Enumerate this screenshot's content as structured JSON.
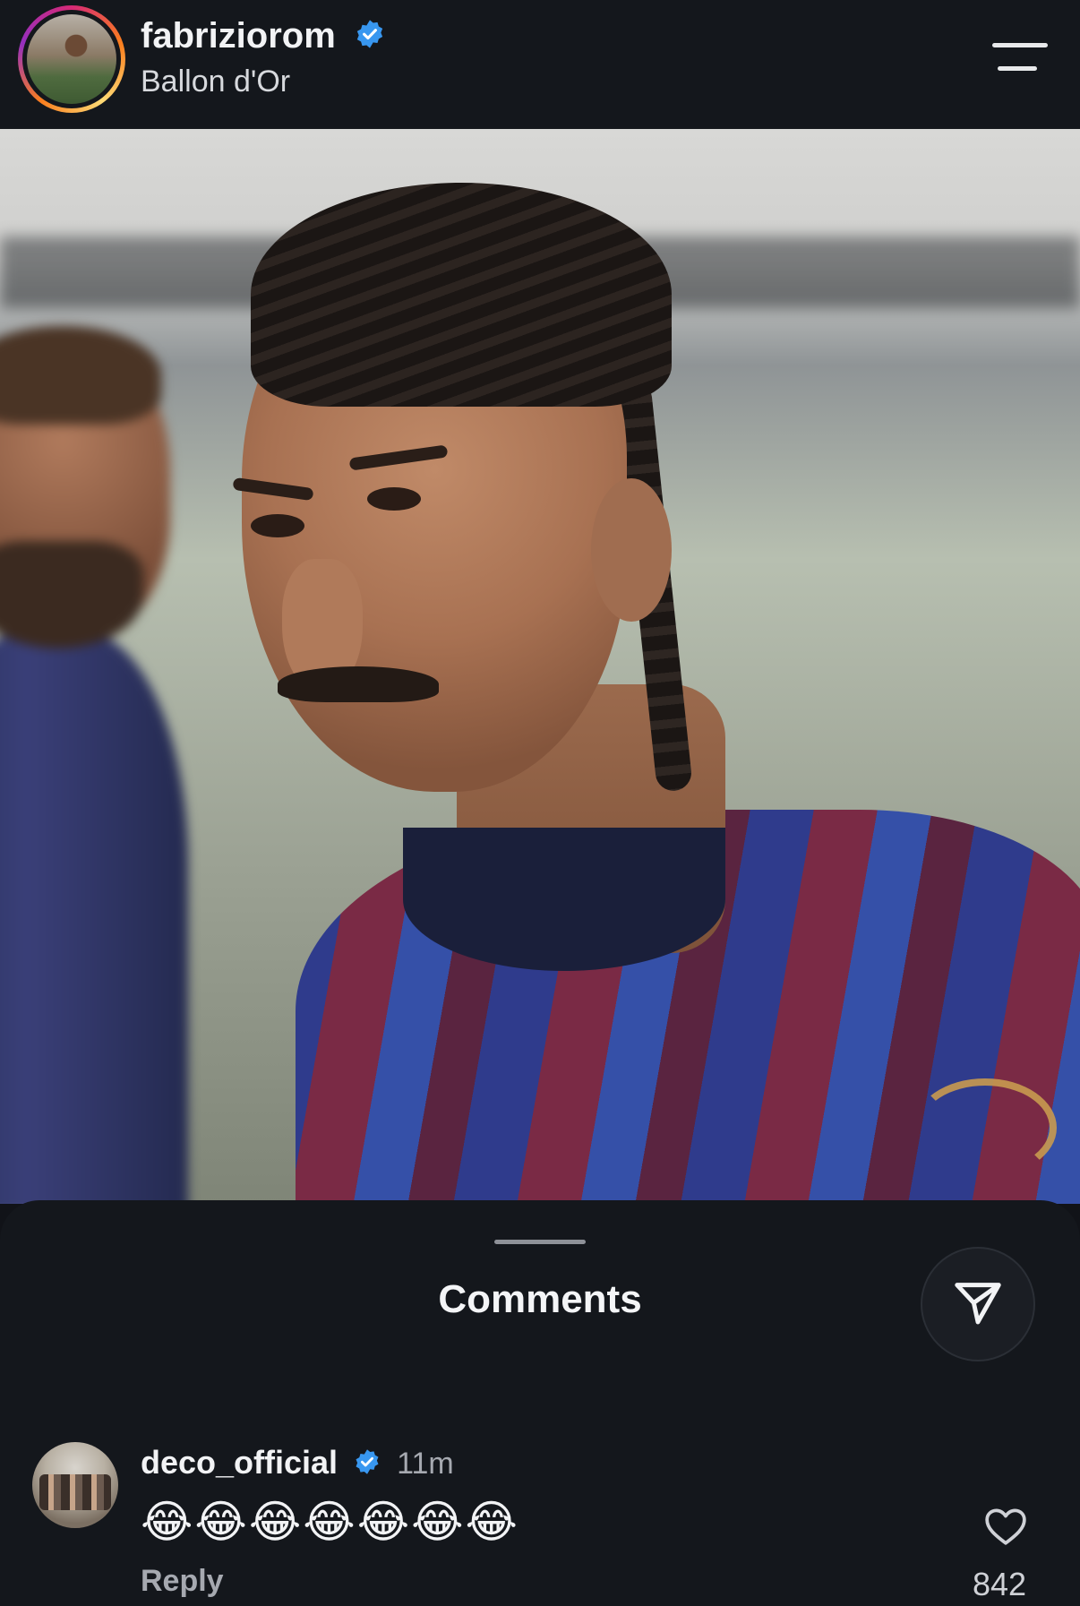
{
  "header": {
    "username": "fabriziorom",
    "subtitle": "Ballon d'Or",
    "verified": true,
    "accent_ring_colors": [
      "#d62976",
      "#fa7e1e",
      "#feda75",
      "#962fbf"
    ],
    "menu_icon": "menu-icon"
  },
  "post": {
    "image_alt": "photo-post"
  },
  "comments_sheet": {
    "title": "Comments",
    "share_icon": "send-icon",
    "comments": [
      {
        "username": "deco_official",
        "verified": true,
        "time": "11m",
        "text": "😂😂😂😂😂😂😂",
        "reply_label": "Reply",
        "likes": "842",
        "like_icon": "heart-icon"
      }
    ]
  },
  "colors": {
    "background": "#14171c",
    "verified_blue": "#3897f0",
    "muted_text": "#a6a9b0"
  }
}
